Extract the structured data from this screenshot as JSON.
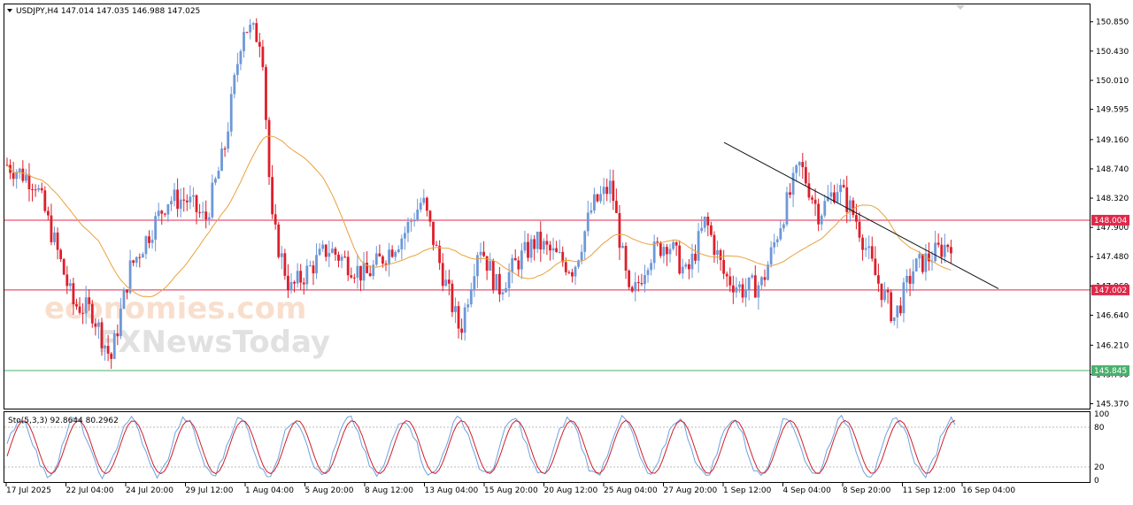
{
  "header": {
    "symbol_line": "USDJPY,H4  147.014 147.035 146.988 147.025"
  },
  "stoch": {
    "label": "Sto(5,3,3) 92.8644 80.2962",
    "levels": [
      "100",
      "80",
      "20",
      "0"
    ]
  },
  "watermark": {
    "line1": "economies.com",
    "line2": "FXNewsToday"
  },
  "colors": {
    "bull": "#6e98d8",
    "bear": "#dd1f2b",
    "ma": "#e8a23c",
    "hline_red": "#e0284a",
    "hline_green": "#49b06d",
    "trend": "#111111",
    "stoch_main": "#6ea2e0",
    "stoch_signal": "#d01f2b"
  },
  "chart_data": {
    "type": "candlestick",
    "symbol": "USDJPY",
    "timeframe": "H4",
    "ohlc_last": {
      "open": 147.014,
      "high": 147.035,
      "low": 146.988,
      "close": 147.025
    },
    "ylim": [
      145.3,
      151.1
    ],
    "y_ticks": [
      "150.850",
      "150.430",
      "150.010",
      "149.595",
      "149.160",
      "148.740",
      "148.320",
      "147.900",
      "147.480",
      "147.060",
      "146.640",
      "146.210",
      "145.790",
      "145.370"
    ],
    "x_ticks": [
      "17 Jul 2025",
      "22 Jul 04:00",
      "24 Jul 20:00",
      "29 Jul 12:00",
      "1 Aug 04:00",
      "5 Aug 20:00",
      "8 Aug 12:00",
      "13 Aug 04:00",
      "15 Aug 20:00",
      "20 Aug 12:00",
      "25 Aug 04:00",
      "27 Aug 20:00",
      "1 Sep 12:00",
      "4 Sep 04:00",
      "8 Sep 20:00",
      "11 Sep 12:00",
      "16 Sep 04:00"
    ],
    "horizontal_levels": [
      {
        "value": 148.004,
        "label": "148.004",
        "color": "#e0284a"
      },
      {
        "value": 147.002,
        "label": "147.002",
        "color": "#e0284a"
      },
      {
        "value": 145.845,
        "label": "145.845",
        "color": "#49b06d"
      }
    ],
    "trendline": [
      [
        0.0,
        149.1
      ],
      [
        1.0,
        146.95
      ]
    ],
    "key_closes": [
      [
        0.0,
        148.8
      ],
      [
        0.03,
        148.55
      ],
      [
        0.05,
        147.7
      ],
      [
        0.07,
        146.8
      ],
      [
        0.09,
        146.7
      ],
      [
        0.11,
        146.0
      ],
      [
        0.13,
        147.3
      ],
      [
        0.15,
        147.8
      ],
      [
        0.17,
        148.3
      ],
      [
        0.19,
        148.3
      ],
      [
        0.21,
        148.0
      ],
      [
        0.23,
        149.0
      ],
      [
        0.25,
        150.8
      ],
      [
        0.27,
        150.6
      ],
      [
        0.28,
        148.0
      ],
      [
        0.3,
        147.0
      ],
      [
        0.32,
        147.3
      ],
      [
        0.34,
        147.6
      ],
      [
        0.36,
        147.4
      ],
      [
        0.38,
        147.2
      ],
      [
        0.4,
        147.5
      ],
      [
        0.42,
        147.8
      ],
      [
        0.44,
        148.3
      ],
      [
        0.46,
        147.3
      ],
      [
        0.48,
        146.4
      ],
      [
        0.5,
        147.7
      ],
      [
        0.52,
        147.0
      ],
      [
        0.54,
        147.4
      ],
      [
        0.56,
        147.7
      ],
      [
        0.58,
        147.5
      ],
      [
        0.6,
        147.3
      ],
      [
        0.62,
        148.2
      ],
      [
        0.64,
        148.5
      ],
      [
        0.66,
        146.8
      ],
      [
        0.68,
        147.5
      ],
      [
        0.7,
        147.7
      ],
      [
        0.72,
        147.2
      ],
      [
        0.74,
        148.0
      ],
      [
        0.76,
        147.2
      ],
      [
        0.78,
        147.0
      ],
      [
        0.8,
        147.1
      ],
      [
        0.82,
        148.0
      ],
      [
        0.84,
        148.8
      ],
      [
        0.86,
        148.1
      ],
      [
        0.88,
        148.5
      ],
      [
        0.9,
        148.0
      ],
      [
        0.92,
        147.2
      ],
      [
        0.94,
        146.6
      ],
      [
        0.96,
        147.3
      ],
      [
        0.98,
        147.5
      ],
      [
        1.0,
        147.7
      ]
    ],
    "note_x": "normalized time position 0..1 across 17 Jul 2025 - 17 Sep 2025"
  }
}
